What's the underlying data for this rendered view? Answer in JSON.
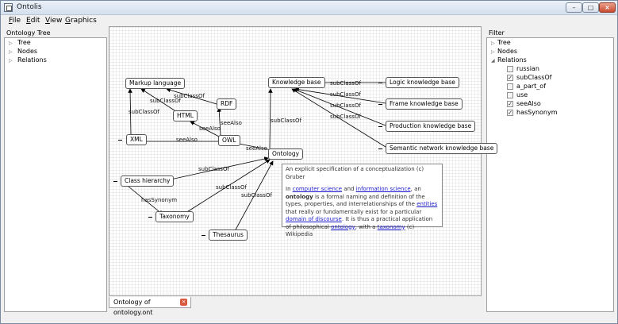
{
  "window": {
    "title": "Ontolis"
  },
  "menu": [
    {
      "label": "File",
      "mnemonic": "F",
      "rest": "ile"
    },
    {
      "label": "Edit",
      "mnemonic": "E",
      "rest": "dit"
    },
    {
      "label": "View",
      "mnemonic": "V",
      "rest": "iew"
    },
    {
      "label": "Graphics",
      "mnemonic": "G",
      "rest": "raphics"
    }
  ],
  "left_panel": {
    "header": "Ontology Tree",
    "items": [
      "Tree",
      "Nodes",
      "Relations"
    ]
  },
  "right_panel": {
    "header": "Filter",
    "items": [
      "Tree",
      "Nodes",
      "Relations"
    ],
    "relations": [
      {
        "label": "russian",
        "checked": false
      },
      {
        "label": "subClassOf",
        "checked": true
      },
      {
        "label": "a_part_of",
        "checked": false
      },
      {
        "label": "use",
        "checked": false
      },
      {
        "label": "seeAlso",
        "checked": true
      },
      {
        "label": "hasSynonym",
        "checked": true
      }
    ]
  },
  "graph": {
    "nodes": {
      "markup": "Markup language",
      "rdf": "RDF",
      "html": "HTML",
      "owl": "OWL",
      "xml": "XML",
      "kb": "Knowledge base",
      "logic": "Logic knowledge base",
      "frame": "Frame knowledge base",
      "production": "Production knowledge base",
      "semantic": "Semantic network knowledge base",
      "ontology": "Ontology",
      "classh": "Class hierarchy",
      "taxonomy": "Taxonomy",
      "thesaurus": "Thesaurus"
    },
    "edge_labels": {
      "subclassof": "subClassOf",
      "seealso": "seeAlso",
      "hassynonym": "hasSynonym"
    }
  },
  "tooltip": {
    "head": "An explicit specification of a conceptualization (c) Gruber",
    "t1": "In ",
    "link1": "computer science",
    "t2": " and ",
    "link2": "information science",
    "t3": ", an ",
    "bold1": "ontology",
    "t4": " is a formal naming and definition of the types, properties, and interrelationships of the ",
    "link3": "entities",
    "t5": " that really or fundamentally exist for a particular ",
    "link4": "domain of discourse",
    "t6": ". It is thus a practical application of philosophical ",
    "link5": "ontology",
    "t7": ", with a ",
    "link6": "taxonomy",
    "t8": " (c) Wikipedia"
  },
  "tab": {
    "label": "Ontology of ontology.ont"
  },
  "icons": {
    "close": "close-icon",
    "minimize": "minimize-icon",
    "maximize": "maximize-icon"
  }
}
